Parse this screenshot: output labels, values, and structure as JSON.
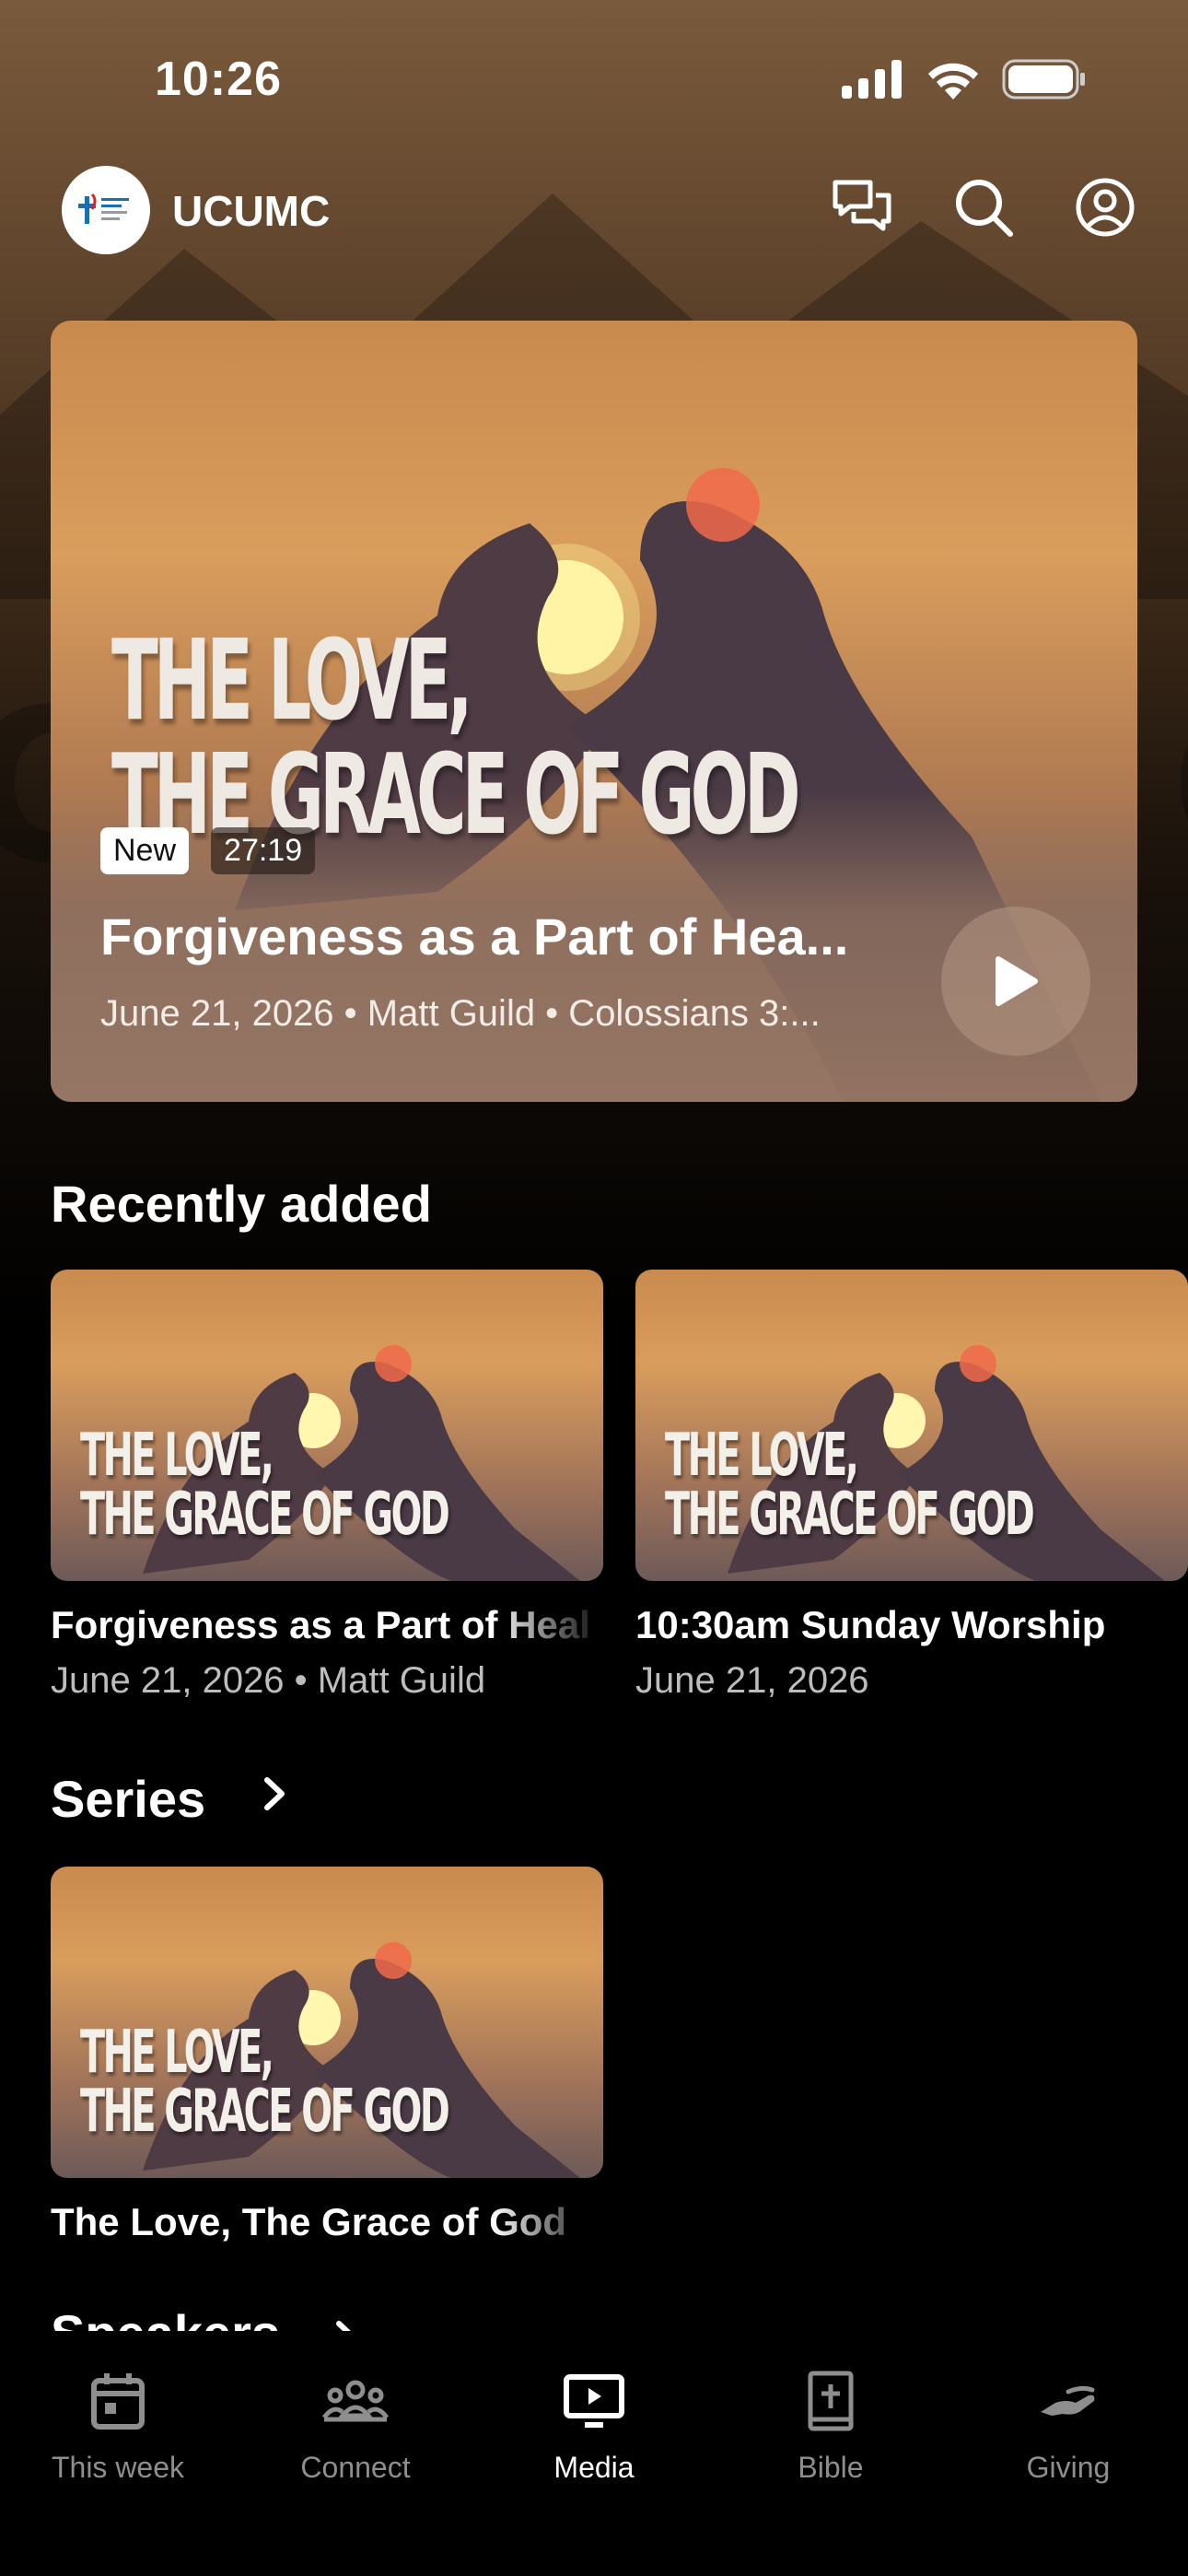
{
  "status_bar": {
    "time": "10:26"
  },
  "header": {
    "brand": "UCUMC",
    "logo_text": "University City United Methodist Church"
  },
  "hero": {
    "art_line1": "THE LOVE,",
    "art_line2": "THE GRACE OF GOD",
    "badge_new": "New",
    "duration": "27:19",
    "title": "Forgiveness as a Part of Hea...",
    "meta": "June 21, 2026 • Matt Guild • Colossians 3:..."
  },
  "recent": {
    "title": "Recently added",
    "items": [
      {
        "art_line1": "THE LOVE,",
        "art_line2": "THE GRACE OF GOD",
        "title": "Forgiveness as a Part of Heal",
        "meta": "June 21, 2026 • Matt Guild"
      },
      {
        "art_line1": "THE LOVE,",
        "art_line2": "THE GRACE OF GOD",
        "title": "10:30am Sunday Worship",
        "meta": "June 21, 2026"
      }
    ]
  },
  "series": {
    "title": "Series",
    "items": [
      {
        "art_line1": "THE LOVE,",
        "art_line2": "THE GRACE OF GOD",
        "title": "The Love, The Grace of God"
      }
    ]
  },
  "speakers": {
    "title": "Speakers"
  },
  "tabs": [
    {
      "label": "This week",
      "icon": "calendar-icon"
    },
    {
      "label": "Connect",
      "icon": "people-icon"
    },
    {
      "label": "Media",
      "icon": "tv-play-icon",
      "active": true
    },
    {
      "label": "Bible",
      "icon": "bible-icon"
    },
    {
      "label": "Giving",
      "icon": "giving-hand-icon"
    }
  ],
  "colors": {
    "background": "#000000",
    "accent": "#ffffff",
    "muted": "#8e8e8e"
  }
}
